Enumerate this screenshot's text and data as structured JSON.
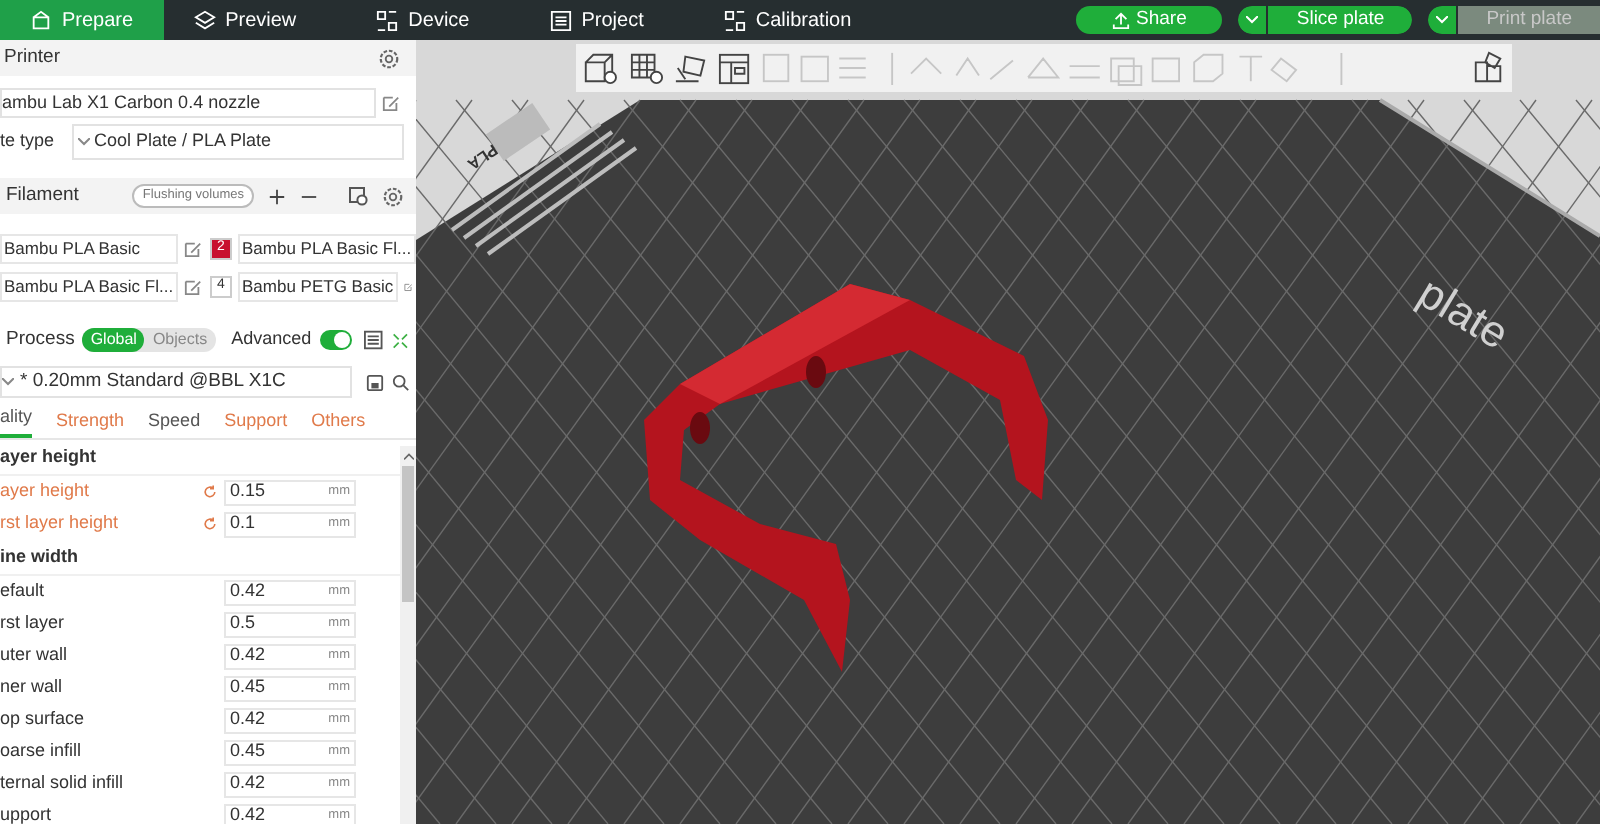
{
  "nav_tabs": [
    {
      "label": "Prepare",
      "selected": true
    },
    {
      "label": "Preview",
      "selected": false
    },
    {
      "label": "Device",
      "selected": false
    },
    {
      "label": "Project",
      "selected": false
    },
    {
      "label": "Calibration",
      "selected": false
    }
  ],
  "actions": [
    {
      "label": "Share",
      "kind": "share",
      "disabled": false
    },
    {
      "label": "Slice plate",
      "kind": "split",
      "disabled": false
    },
    {
      "label": "Print plate",
      "kind": "split",
      "disabled": true
    }
  ],
  "printer": {
    "title": "Printer",
    "preset": "ambu Lab X1 Carbon 0.4 nozzle",
    "plate_type_label": "te type",
    "plate_type": "Cool Plate / PLA Plate"
  },
  "filament": {
    "title": "Filament",
    "flushing_button": "Flushing volumes",
    "items": [
      {
        "name": "Bambu PLA Basic"
      },
      {
        "index": "2",
        "name": "Bambu PLA Basic Fl...",
        "color": "#c8102e"
      },
      {
        "name": "Bambu PLA Basic Fl..."
      },
      {
        "index": "4",
        "name": "Bambu PETG Basic",
        "color": "#ffffff"
      }
    ]
  },
  "process": {
    "title": "Process",
    "scopes": [
      {
        "label": "Global",
        "selected": true
      },
      {
        "label": "Objects",
        "selected": false
      }
    ],
    "advanced_label": "Advanced",
    "advanced_on": true,
    "preset": "* 0.20mm Standard @BBL X1C",
    "tabs": [
      {
        "label": "ality",
        "selected": true,
        "modified": false
      },
      {
        "label": "Strength",
        "selected": false,
        "modified": true
      },
      {
        "label": "Speed",
        "selected": false,
        "modified": false
      },
      {
        "label": "Support",
        "selected": false,
        "modified": true
      },
      {
        "label": "Others",
        "selected": false,
        "modified": true
      }
    ],
    "groups": [
      {
        "title": "ayer height",
        "rows": [
          {
            "label": "ayer height",
            "value": "0.15",
            "unit": "mm",
            "modified": true
          },
          {
            "label": "rst layer height",
            "value": "0.1",
            "unit": "mm",
            "modified": true
          }
        ]
      },
      {
        "title": "ine width",
        "rows": [
          {
            "label": "efault",
            "value": "0.42",
            "unit": "mm",
            "modified": false
          },
          {
            "label": "rst layer",
            "value": "0.5",
            "unit": "mm",
            "modified": false
          },
          {
            "label": "uter wall",
            "value": "0.42",
            "unit": "mm",
            "modified": false
          },
          {
            "label": "ner wall",
            "value": "0.45",
            "unit": "mm",
            "modified": false
          },
          {
            "label": "op surface",
            "value": "0.42",
            "unit": "mm",
            "modified": false
          },
          {
            "label": "oarse infill",
            "value": "0.45",
            "unit": "mm",
            "modified": false
          },
          {
            "label": "ternal solid infill",
            "value": "0.42",
            "unit": "mm",
            "modified": false
          },
          {
            "label": "upport",
            "value": "0.42",
            "unit": "mm",
            "modified": false
          }
        ]
      }
    ]
  },
  "viewport": {
    "plate_label": "PLA",
    "plate_text": "plate"
  }
}
